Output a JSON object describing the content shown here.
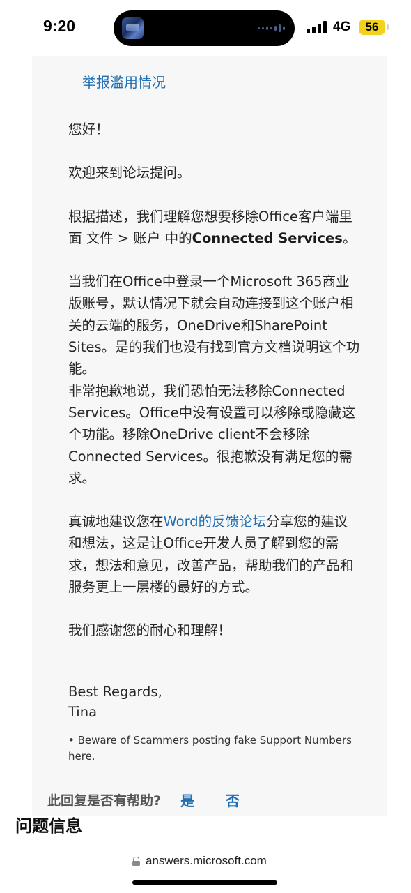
{
  "status_bar": {
    "time": "9:20",
    "network": "4G",
    "battery": "56"
  },
  "answer": {
    "report_link": "举报滥用情况",
    "greeting": "您好！",
    "welcome": "欢迎来到论坛提问。",
    "understanding_prefix": "根据描述，我们理解您想要移除Office客户端里面 文件 > 账户 中的",
    "understanding_bold": "Connected Services",
    "understanding_suffix": "。",
    "explanation": "当我们在Office中登录一个Microsoft 365商业版账号，默认情况下就会自动连接到这个账户相关的云端的服务，OneDrive和SharePoint Sites。是的我们也没有找到官方文档说明这个功能。",
    "apology": "非常抱歉地说，我们恐怕无法移除Connected Services。Office中没有设置可以移除或隐藏这个功能。移除OneDrive client不会移除Connected Services。很抱歉没有满足您的需求。",
    "suggestion_prefix": "真诚地建议您在",
    "suggestion_link": "Word的反馈论坛",
    "suggestion_suffix": "分享您的建议和想法，这是让Office开发人员了解到您的需求，想法和意见，改善产品，帮助我们的产品和服务更上一层楼的最好的方式。",
    "thanks": "我们感谢您的耐心和理解！",
    "signoff_line1": "Best Regards,",
    "signoff_line2": "Tina",
    "disclaimer": "• Beware of Scammers posting fake Support Numbers here.",
    "helpful_question": "此回复是否有帮助?",
    "helpful_yes": "是",
    "helpful_no": "否"
  },
  "section": {
    "heading": "问题信息"
  },
  "browser": {
    "url": "answers.microsoft.com"
  }
}
